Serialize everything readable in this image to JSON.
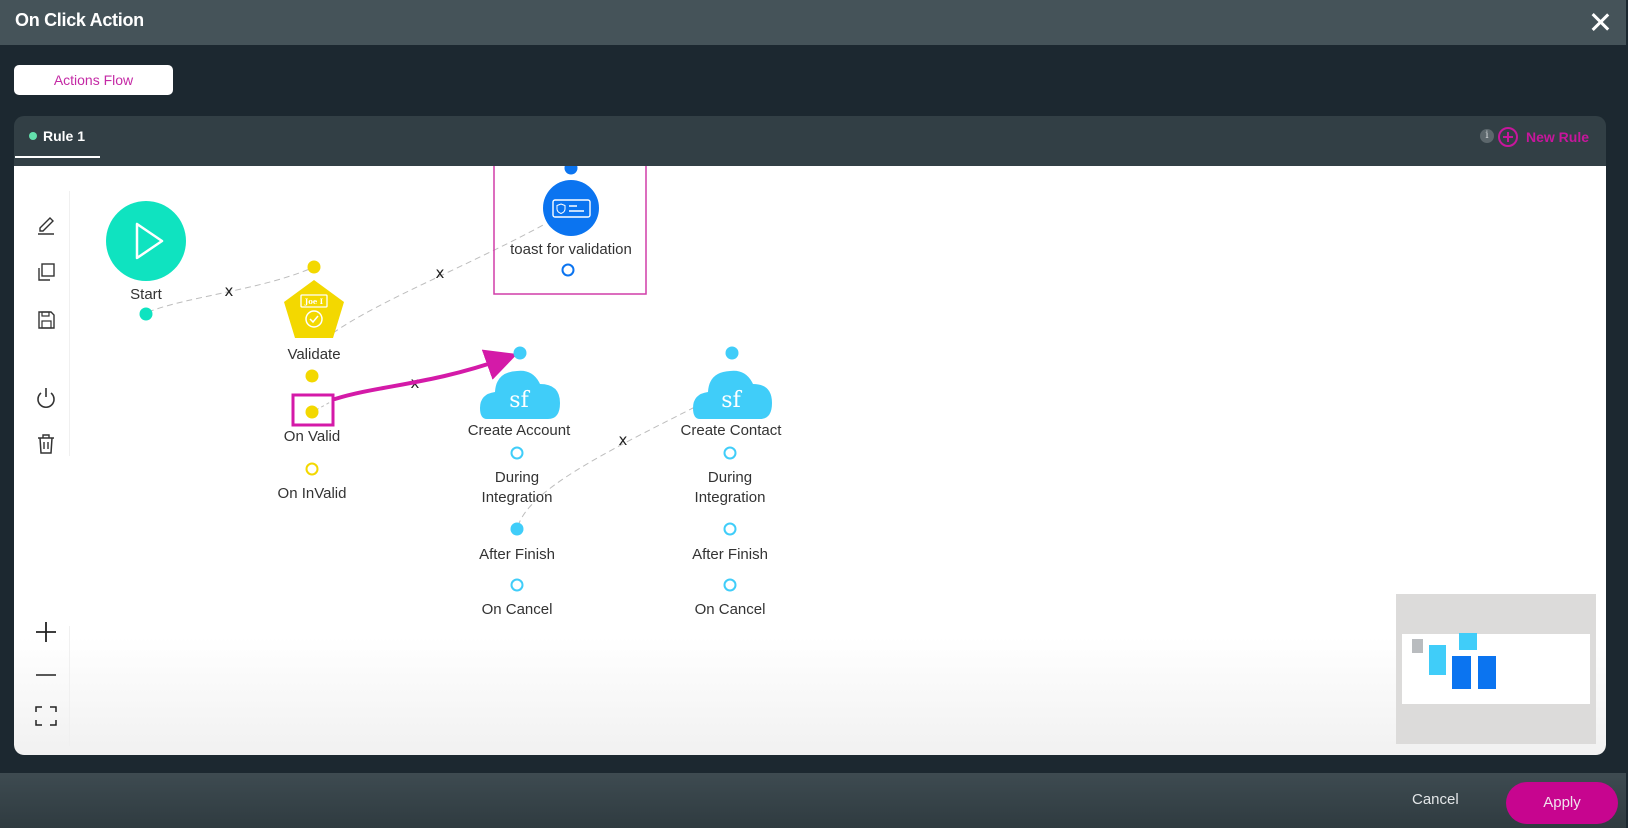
{
  "dialog": {
    "title": "On Click Action",
    "close_icon": "close-x-icon"
  },
  "view_toggle": {
    "label": "Actions Flow"
  },
  "rules": {
    "tabs": [
      {
        "label": "Rule 1",
        "active": true,
        "status_color": "#63e0ac"
      }
    ],
    "info_icon": "info-icon",
    "info_glyph": "i",
    "new_rule_label": "New Rule",
    "accent_color": "#c7169c"
  },
  "toolbar": {
    "items": [
      {
        "name": "edit",
        "icon": "pencil-icon"
      },
      {
        "name": "duplicate",
        "icon": "copy-icon"
      },
      {
        "name": "save",
        "icon": "save-icon"
      },
      {
        "name": "toggle",
        "icon": "power-icon"
      },
      {
        "name": "delete",
        "icon": "trash-icon"
      }
    ],
    "zoom": [
      {
        "name": "zoom-in",
        "icon": "plus-icon"
      },
      {
        "name": "zoom-out",
        "icon": "minus-icon"
      },
      {
        "name": "fit",
        "icon": "fit-screen-icon"
      }
    ]
  },
  "flow": {
    "nodes": {
      "start": {
        "label": "Start",
        "color": "#0fe3c0",
        "icon": "play-icon"
      },
      "validate": {
        "label": "Validate",
        "color": "#f3d800",
        "icon": "validate-badge-icon",
        "badge_text": "Joe I",
        "outputs": [
          {
            "label": "On Valid",
            "filled": true,
            "highlighted": true
          },
          {
            "label": "On InValid",
            "filled": false
          }
        ]
      },
      "toast": {
        "label": "toast for validation",
        "color": "#0b74f0",
        "icon": "toast-card-icon",
        "selected": true
      },
      "create_account": {
        "label": "Create Account",
        "color": "#40cdf9",
        "icon_text": "sf",
        "outputs": [
          {
            "label_lines": [
              "During",
              "Integration"
            ],
            "filled": false
          },
          {
            "label": "After Finish",
            "filled": true
          },
          {
            "label": "On Cancel",
            "filled": false
          }
        ]
      },
      "create_contact": {
        "label": "Create Contact",
        "color": "#40cdf9",
        "icon_text": "sf",
        "outputs": [
          {
            "label_lines": [
              "During",
              "Integration"
            ],
            "filled": false
          },
          {
            "label": "After Finish",
            "filled": false
          },
          {
            "label": "On Cancel",
            "filled": false
          }
        ]
      }
    },
    "connections": [
      {
        "from": "start",
        "to": "validate",
        "remove_label": "x"
      },
      {
        "from": "validate",
        "to": "toast",
        "remove_label": "x"
      },
      {
        "from": "validate.on_valid",
        "to": "create_account",
        "remove_label": "x",
        "highlighted": true,
        "highlight_color": "#d41aa8"
      },
      {
        "from": "create_account.after_finish",
        "to": "create_contact",
        "remove_label": "x"
      }
    ]
  },
  "minimap": {
    "label": "minimap"
  },
  "footer": {
    "cancel_label": "Cancel",
    "apply_label": "Apply",
    "apply_color": "#c7058f"
  }
}
